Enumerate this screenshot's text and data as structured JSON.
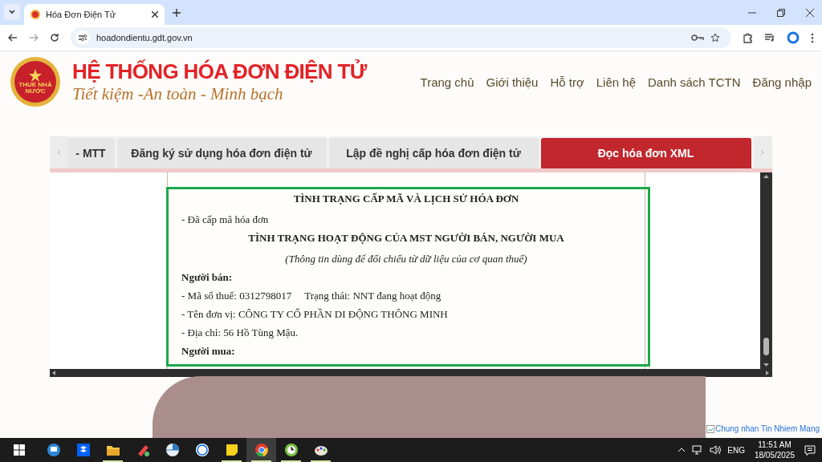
{
  "browser": {
    "tabs": [
      {
        "title": "Hóa Đơn Điện Tử",
        "selected": true
      }
    ],
    "url": "hoadondientu.gdt.gov.vn"
  },
  "site": {
    "logo_text": "THUẾ NHÀ NƯỚC",
    "title": "HỆ THỐNG HÓA ĐƠN ĐIỆN TỬ",
    "slogan": "Tiết kiệm -An toàn - Minh bạch",
    "nav": [
      "Trang chủ",
      "Giới thiệu",
      "Hỗ trợ",
      "Liên hệ",
      "Danh sách TCTN",
      "Đăng nhập"
    ]
  },
  "tabs": [
    {
      "label": "- MTT",
      "selected": false
    },
    {
      "label": "Đăng ký sử dụng hóa đơn điện tử",
      "selected": false
    },
    {
      "label": "Lập đề nghị cấp hóa đơn điện tử",
      "selected": false
    },
    {
      "label": "Đọc hóa đơn XML",
      "selected": true
    }
  ],
  "document": {
    "lines": [
      {
        "kind": "heading",
        "text": "TÌNH TRẠNG CẤP MÃ VÀ LỊCH SỬ HÓA ĐƠN"
      },
      {
        "kind": "item",
        "text": "- Đã cấp mã hóa đơn"
      },
      {
        "kind": "heading",
        "text": "TÌNH TRẠNG HOẠT ĐỘNG CỦA MST NGƯỜI BÁN, NGƯỜI MUA"
      },
      {
        "kind": "note",
        "text": "(Thông tin dùng để đối chiếu từ dữ liệu của cơ quan thuế)"
      },
      {
        "kind": "label",
        "text": "Người bán:"
      },
      {
        "kind": "pair",
        "text": "- Mã số thuế: 0312798017",
        "extra": "Trạng thái: NNT đang hoạt động"
      },
      {
        "kind": "item",
        "text": "- Tên đơn vị: CÔNG TY CỔ PHẦN DI ĐỘNG THÔNG MINH"
      },
      {
        "kind": "item",
        "text": "- Địa chỉ: 56 Hồ Tùng Mậu."
      },
      {
        "kind": "label",
        "text": "Người mua:"
      }
    ]
  },
  "certificate_link": "Chung nhan Tin Nhiem Mang",
  "taskbar": {
    "apps": [
      {
        "kind": "remote",
        "selected": false,
        "running": false
      },
      {
        "kind": "dropbox",
        "selected": false,
        "running": false
      },
      {
        "kind": "folder",
        "selected": false,
        "running": true
      },
      {
        "kind": "paint",
        "selected": false,
        "running": false
      },
      {
        "kind": "disk",
        "selected": false,
        "running": false
      },
      {
        "kind": "zalo",
        "selected": false,
        "running": false
      },
      {
        "kind": "note",
        "selected": false,
        "running": true
      },
      {
        "kind": "browser",
        "selected": true,
        "running": true
      },
      {
        "kind": "clock",
        "selected": false,
        "running": true
      },
      {
        "kind": "palette",
        "selected": false,
        "running": true
      }
    ],
    "language": "ENG",
    "time": "11:51 AM",
    "date": "18/05/2025"
  }
}
